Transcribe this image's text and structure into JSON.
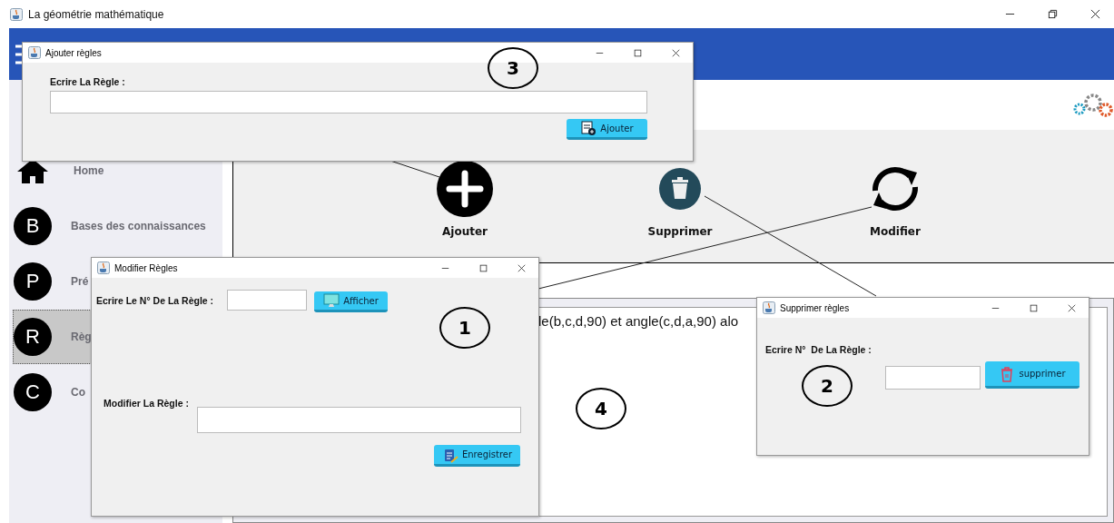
{
  "window": {
    "title": "La géométrie mathématique"
  },
  "sidebar": {
    "items": [
      {
        "kind": "home",
        "label": "Home",
        "selected": false
      },
      {
        "kind": "letter",
        "letter": "B",
        "label": "Bases des connaissances",
        "selected": false
      },
      {
        "kind": "letter",
        "letter": "P",
        "label": "Pré",
        "selected": false
      },
      {
        "kind": "letter",
        "letter": "R",
        "label": "Règ",
        "selected": true
      },
      {
        "kind": "letter",
        "letter": "C",
        "label": "Co",
        "selected": false
      }
    ]
  },
  "toolbar": {
    "actions": [
      {
        "kind": "add",
        "label": "Ajouter"
      },
      {
        "kind": "delete",
        "label": "Supprimer"
      },
      {
        "kind": "refresh",
        "label": "Modifier"
      }
    ]
  },
  "rules_panel": {
    "text": "le(b,c,d,90) et angle(c,d,a,90) alo"
  },
  "dialogs": [
    {
      "kind": "add",
      "title": "Ajouter règles",
      "label": "Ecrire La Règle :",
      "button": "Ajouter"
    },
    {
      "kind": "modify",
      "title": "Modifier Règles",
      "label": "Ecrire Le N° De La Règle :",
      "button": "Afficher",
      "label_2": "Modifier La Règle :",
      "button_2": "Enregistrer"
    },
    {
      "kind": "delete",
      "title": "Supprimer règles",
      "label": "Ecrire N°  De La Règle :",
      "button": "supprimer"
    }
  ],
  "callouts": [
    "3",
    "1",
    "2",
    "4"
  ]
}
